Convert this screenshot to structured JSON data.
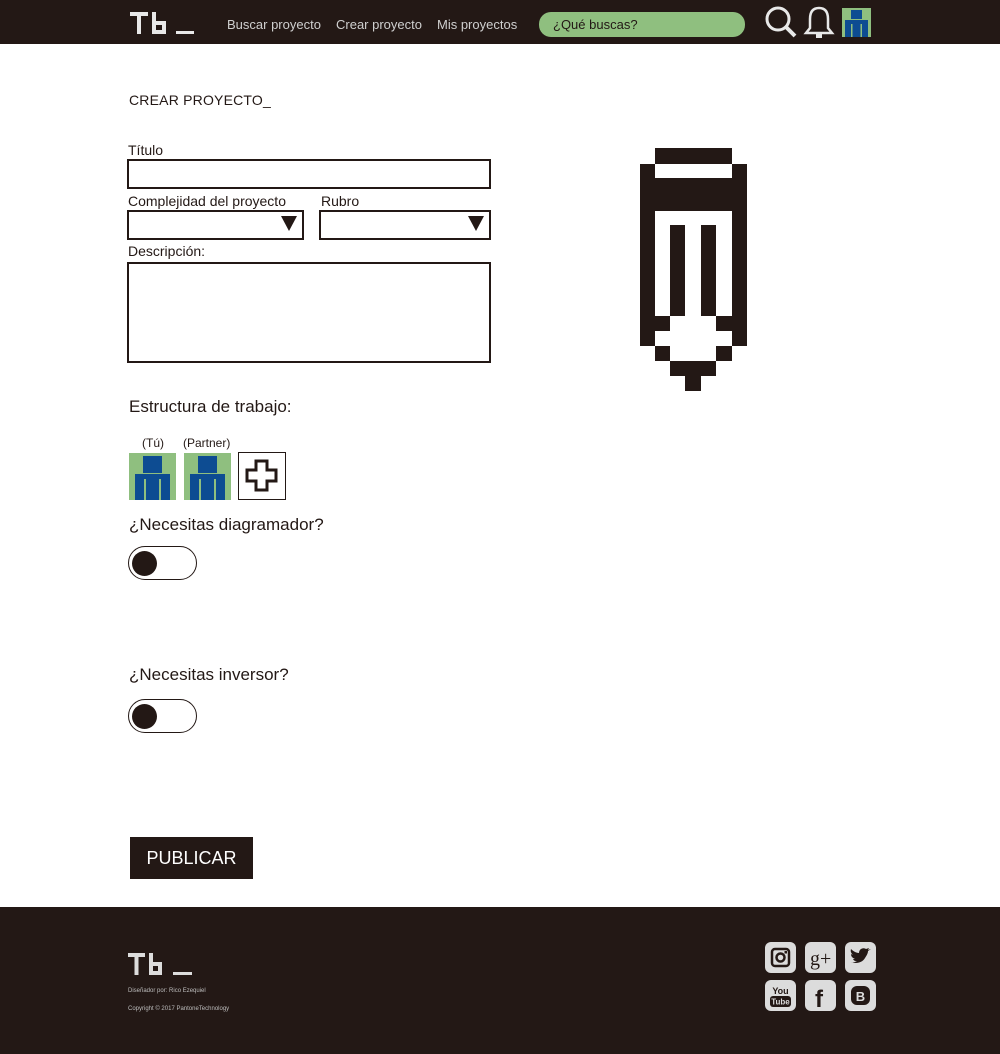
{
  "header": {
    "logo_text": "Tb_",
    "nav": [
      "Buscar proyecto",
      "Crear proyecto",
      "Mis proyectos"
    ],
    "search_placeholder": "¿Qué buscas?",
    "icons": [
      "search-icon",
      "bell-icon",
      "user-avatar"
    ]
  },
  "form": {
    "page_title": "CREAR PROYECTO_",
    "title_label": "Título",
    "title_value": "",
    "complexity_label": "Complejidad del proyecto",
    "complexity_value": "",
    "category_label": "Rubro",
    "category_value": "",
    "description_label": "Descripción:",
    "description_value": ""
  },
  "team": {
    "heading": "Estructura de trabajo:",
    "members": [
      {
        "label": "(Tú)"
      },
      {
        "label": "(Partner)"
      }
    ],
    "add_icon": "plus-icon"
  },
  "options": {
    "designer_question": "¿Necesitas diagramador?",
    "designer_enabled": false,
    "investor_question": "¿Necesitas inversor?",
    "investor_enabled": false
  },
  "actions": {
    "publish_label": "PUBLICAR"
  },
  "illustration": "pencil-icon",
  "footer": {
    "logo_text": "Tb_",
    "credit": "Diseñador por: Rico Ezequiel",
    "copyright": "Copyright © 2017 PantoneTechnology",
    "social": [
      "instagram-icon",
      "google-plus-icon",
      "twitter-icon",
      "youtube-icon",
      "facebook-icon",
      "blogger-icon"
    ],
    "social_glyphs": {
      "google_plus": "g+",
      "youtube_top": "You",
      "youtube_bottom": "Tube",
      "facebook": "f",
      "blogger": "B"
    }
  },
  "colors": {
    "dark": "#231815",
    "accent_green": "#8fbf7f",
    "avatar_blue": "#0d4c92",
    "white": "#ffffff"
  }
}
